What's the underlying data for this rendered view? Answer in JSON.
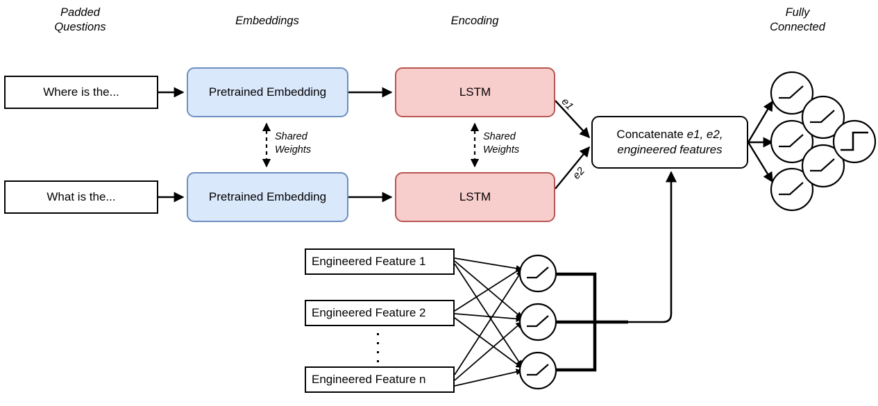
{
  "diagram": {
    "title_columns": [
      {
        "name": "padded-questions",
        "label": "Padded\nQuestions"
      },
      {
        "name": "embeddings",
        "label": "Embeddings"
      },
      {
        "name": "encoding",
        "label": "Encoding"
      },
      {
        "name": "fully-connected",
        "label": "Fully\nConnected"
      }
    ],
    "questions": [
      {
        "label": "Where is the..."
      },
      {
        "label": "What is the..."
      }
    ],
    "embeddings": [
      {
        "label": "Pretrained Embedding"
      },
      {
        "label": "Pretrained Embedding"
      }
    ],
    "encoders": [
      {
        "label": "LSTM"
      },
      {
        "label": "LSTM"
      }
    ],
    "shared_weights": [
      {
        "label": "Shared\nWeights"
      },
      {
        "label": "Shared\nWeights"
      }
    ],
    "encoding_outputs": [
      {
        "label": "e1"
      },
      {
        "label": "e2"
      }
    ],
    "concatenate": {
      "prefix": "Concatenate ",
      "italic_part": "e1, e2,\nengineered features"
    },
    "engineered_features": [
      {
        "label": "Engineered Feature 1"
      },
      {
        "label": "Engineered Feature 2"
      },
      {
        "label": "Engineered Feature n"
      }
    ],
    "ellipsis": "⋮",
    "neurons": {
      "activation_icon": "relu-icon",
      "output_activation_icon": "step-function-icon",
      "fc_layer1_count": 3,
      "fc_layer2_count": 2,
      "fc_output_count": 1,
      "feature_layer_count": 3
    },
    "colors": {
      "embedding_fill": "#dae8fc",
      "embedding_stroke": "#6c8ebf",
      "lstm_fill": "#f8cecc",
      "lstm_stroke": "#b85450",
      "box_fill": "#ffffff",
      "box_stroke": "#000000",
      "background": "#ffffff"
    }
  }
}
